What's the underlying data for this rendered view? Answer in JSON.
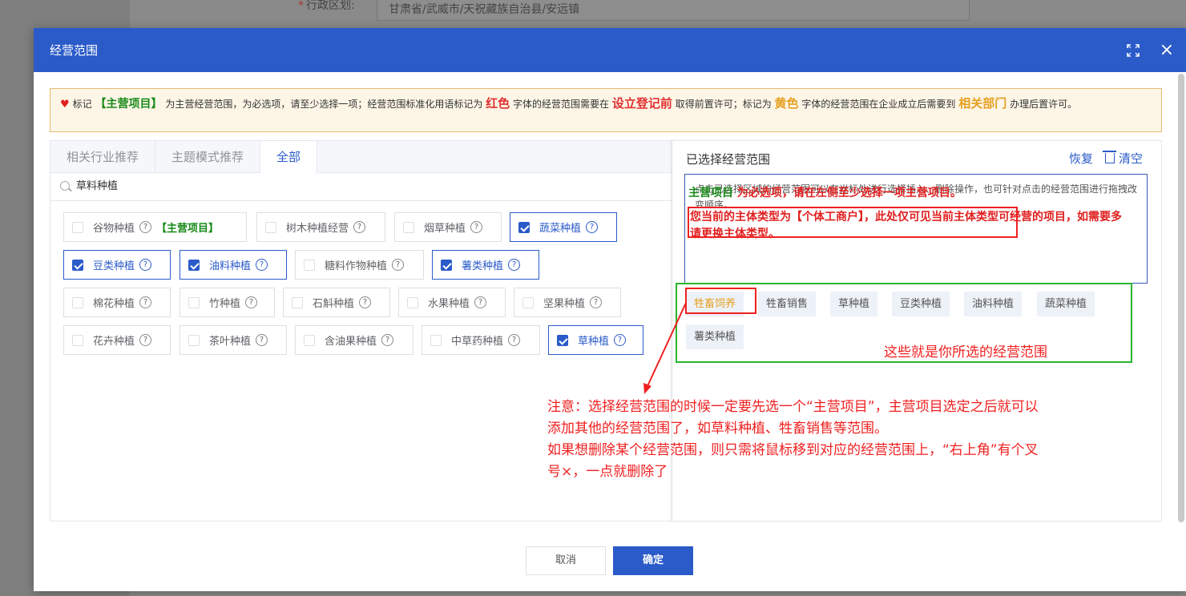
{
  "background": {
    "field_label": "行政区划:",
    "field_required": "*",
    "field_value": "甘肃省/武威市/天祝藏族自治县/安远镇",
    "bottom_text": "— —"
  },
  "dialog": {
    "title": "经营范围",
    "close_icon": "×"
  },
  "notice": {
    "part1": "标记",
    "main_item": "【主营项目】",
    "part2": "为主营经营范围，为必选项，请至少选择一项；经营范围标准化用语标记为",
    "red_word": "红色",
    "part3": "字体的经营范围需要在",
    "red_phase": "设立登记前",
    "part4": "取得前置许可；标记为",
    "yellow_word": "黄色",
    "part5": "字体的经营范围在企业成立后需要到",
    "dept": "相关部门",
    "part6": "办理后置许可。"
  },
  "tabs": [
    {
      "label": "相关行业推荐"
    },
    {
      "label": "主题模式推荐"
    },
    {
      "label": "全部"
    }
  ],
  "search": {
    "value": "草料种植"
  },
  "options": [
    {
      "label": "谷物种植",
      "checked": false,
      "main": "【主营项目】"
    },
    {
      "label": "树木种植经营",
      "checked": false
    },
    {
      "label": "烟草种植",
      "checked": false
    },
    {
      "label": "蔬菜种植",
      "checked": true
    },
    {
      "label": "豆类种植",
      "checked": true
    },
    {
      "label": "油料种植",
      "checked": true
    },
    {
      "label": "糖料作物种植",
      "checked": false
    },
    {
      "label": "薯类种植",
      "checked": true
    },
    {
      "label": "棉花种植",
      "checked": false
    },
    {
      "label": "竹种植",
      "checked": false
    },
    {
      "label": "石斛种植",
      "checked": false
    },
    {
      "label": "水果种植",
      "checked": false
    },
    {
      "label": "坚果种植",
      "checked": false
    },
    {
      "label": "花卉种植",
      "checked": false
    },
    {
      "label": "茶叶种植",
      "checked": false
    },
    {
      "label": "含油果种植",
      "checked": false
    },
    {
      "label": "中草药种植",
      "checked": false
    },
    {
      "label": "草种植",
      "checked": true
    }
  ],
  "right_panel": {
    "title": "已选择经营范围",
    "restore": "恢复",
    "clear": "清空",
    "hint": "点击已选择区域的经营范围可以在光标处进行选择插入、删除操作，也可针对点击的经营范围进行拖拽改变顺序。",
    "main_label": "主营项目",
    "main_msg": "为必选项，请在左侧至少选择一项主营项目。",
    "type_msg": "您当前的主体类型为【个体工商户】，此处仅可见当前主体类型可经营的项目，如需要多请更换主体类型。"
  },
  "selected": [
    {
      "label": "牲畜饲养"
    },
    {
      "label": "牲畜销售"
    },
    {
      "label": "草种植"
    },
    {
      "label": "豆类种植"
    },
    {
      "label": "油料种植"
    },
    {
      "label": "蔬菜种植"
    },
    {
      "label": "薯类种植"
    }
  ],
  "annotations": {
    "selected_note": "这些就是你所选的经营范围",
    "note_line1": "注意：选择经营范围的时候一定要先选一个“主营项目”，主营项目选定之后就可以",
    "note_line2": "添加其他的经营范围了，如草料种植、牲畜销售等范围。",
    "note_line3": "如果想删除某个经营范围，则只需将鼠标移到对应的经营范围上，“右上角”有个叉",
    "note_line4": "号×，一点就删除了"
  },
  "footer": {
    "cancel": "取消",
    "confirm": "确定"
  },
  "colors": {
    "primary": "#2b5bc9",
    "annotation_red": "#f02020",
    "annotation_green": "#2cb52c",
    "main_green": "#1a8a1a",
    "warn_yellow": "#e6a020"
  }
}
